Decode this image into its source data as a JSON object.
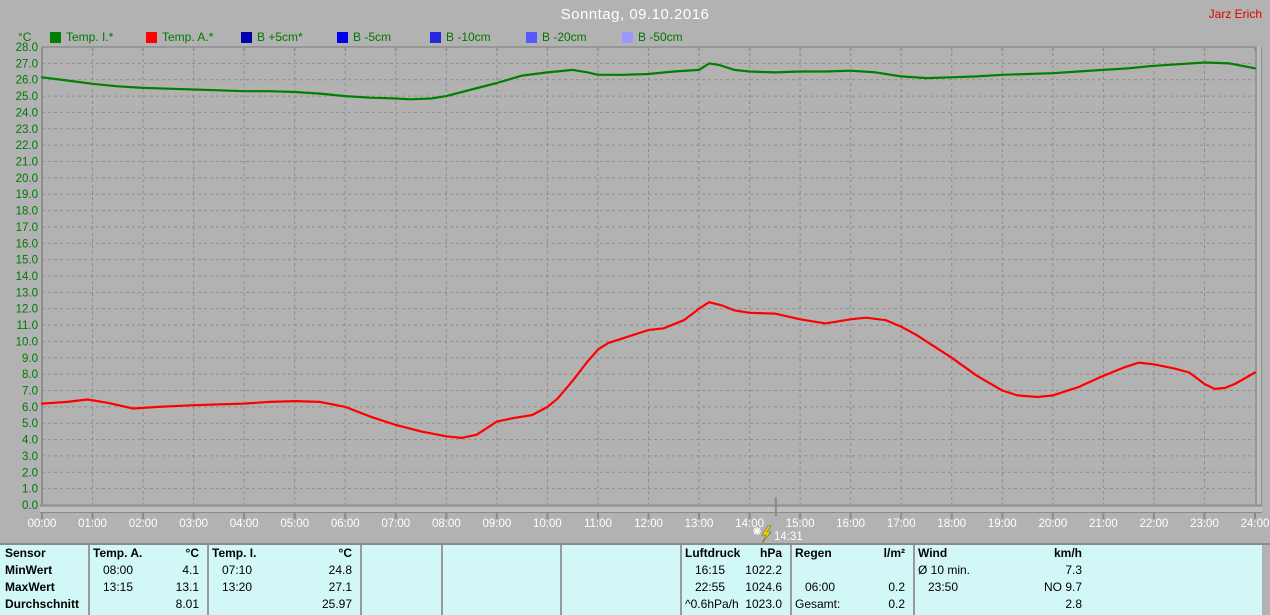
{
  "header": {
    "title": "Sonntag, 09.10.2016",
    "author": "Jarz Erich"
  },
  "legend": {
    "unit": "°C",
    "position": "top",
    "items": [
      {
        "label": "Temp. I.*",
        "color": "#008000"
      },
      {
        "label": "Temp. A.*",
        "color": "#ff0000"
      },
      {
        "label": "B +5cm*",
        "color": "#0000a8"
      },
      {
        "label": "B -5cm",
        "color": "#0000f0"
      },
      {
        "label": "B -10cm",
        "color": "#2626dd"
      },
      {
        "label": "B -20cm",
        "color": "#5858ff"
      },
      {
        "label": "B -50cm",
        "color": "#9898ff"
      }
    ]
  },
  "chart_data": {
    "type": "line",
    "title": "Sonntag, 09.10.2016",
    "grid": true,
    "legend_position": "top",
    "x_axis": {
      "min": 0,
      "max": 24,
      "step": 1,
      "tick_labels": [
        "00:00",
        "01:00",
        "02:00",
        "03:00",
        "04:00",
        "05:00",
        "06:00",
        "07:00",
        "08:00",
        "09:00",
        "10:00",
        "11:00",
        "12:00",
        "13:00",
        "14:00",
        "15:00",
        "16:00",
        "17:00",
        "18:00",
        "19:00",
        "20:00",
        "21:00",
        "22:00",
        "23:00",
        "24:00"
      ]
    },
    "y_axis": {
      "min": 0,
      "max": 28,
      "step": 1,
      "decimals": 1,
      "unit": "°C"
    },
    "cursor": {
      "label": "14:31",
      "hour": 14.52
    },
    "series": [
      {
        "name": "Temp. I.*",
        "color": "#008000",
        "points": [
          [
            0,
            26.15
          ],
          [
            0.5,
            25.95
          ],
          [
            1,
            25.75
          ],
          [
            1.5,
            25.6
          ],
          [
            2,
            25.5
          ],
          [
            2.5,
            25.45
          ],
          [
            3,
            25.4
          ],
          [
            3.5,
            25.35
          ],
          [
            4,
            25.3
          ],
          [
            4.5,
            25.3
          ],
          [
            5,
            25.25
          ],
          [
            5.5,
            25.15
          ],
          [
            6,
            25.0
          ],
          [
            6.5,
            24.9
          ],
          [
            7,
            24.85
          ],
          [
            7.3,
            24.8
          ],
          [
            7.7,
            24.85
          ],
          [
            8,
            25.0
          ],
          [
            8.5,
            25.4
          ],
          [
            9,
            25.8
          ],
          [
            9.5,
            26.25
          ],
          [
            10,
            26.45
          ],
          [
            10.5,
            26.6
          ],
          [
            10.8,
            26.45
          ],
          [
            11,
            26.3
          ],
          [
            11.5,
            26.3
          ],
          [
            12,
            26.35
          ],
          [
            12.5,
            26.5
          ],
          [
            13,
            26.6
          ],
          [
            13.2,
            27.0
          ],
          [
            13.4,
            26.9
          ],
          [
            13.7,
            26.6
          ],
          [
            14,
            26.5
          ],
          [
            14.5,
            26.45
          ],
          [
            15,
            26.5
          ],
          [
            15.5,
            26.5
          ],
          [
            16,
            26.55
          ],
          [
            16.5,
            26.45
          ],
          [
            17,
            26.2
          ],
          [
            17.5,
            26.1
          ],
          [
            18,
            26.15
          ],
          [
            18.5,
            26.2
          ],
          [
            19,
            26.3
          ],
          [
            19.5,
            26.35
          ],
          [
            20,
            26.4
          ],
          [
            20.5,
            26.5
          ],
          [
            21,
            26.6
          ],
          [
            21.5,
            26.7
          ],
          [
            22,
            26.85
          ],
          [
            22.5,
            26.95
          ],
          [
            23,
            27.05
          ],
          [
            23.5,
            27.0
          ],
          [
            24,
            26.7
          ]
        ]
      },
      {
        "name": "Temp. A.*",
        "color": "#ff0000",
        "points": [
          [
            0,
            6.2
          ],
          [
            0.5,
            6.3
          ],
          [
            0.9,
            6.45
          ],
          [
            1.3,
            6.25
          ],
          [
            1.8,
            5.9
          ],
          [
            2.3,
            6.0
          ],
          [
            3,
            6.1
          ],
          [
            3.5,
            6.15
          ],
          [
            4,
            6.2
          ],
          [
            4.5,
            6.3
          ],
          [
            5,
            6.35
          ],
          [
            5.5,
            6.3
          ],
          [
            6,
            6.0
          ],
          [
            6.5,
            5.4
          ],
          [
            7,
            4.9
          ],
          [
            7.5,
            4.5
          ],
          [
            8,
            4.2
          ],
          [
            8.3,
            4.1
          ],
          [
            8.6,
            4.3
          ],
          [
            9,
            5.1
          ],
          [
            9.3,
            5.3
          ],
          [
            9.7,
            5.5
          ],
          [
            10,
            6.0
          ],
          [
            10.2,
            6.5
          ],
          [
            10.5,
            7.6
          ],
          [
            10.8,
            8.8
          ],
          [
            11,
            9.5
          ],
          [
            11.2,
            9.9
          ],
          [
            11.5,
            10.2
          ],
          [
            12,
            10.7
          ],
          [
            12.3,
            10.8
          ],
          [
            12.7,
            11.3
          ],
          [
            13,
            12.0
          ],
          [
            13.2,
            12.4
          ],
          [
            13.45,
            12.2
          ],
          [
            13.7,
            11.9
          ],
          [
            14,
            11.75
          ],
          [
            14.5,
            11.7
          ],
          [
            15,
            11.35
          ],
          [
            15.5,
            11.1
          ],
          [
            16,
            11.35
          ],
          [
            16.3,
            11.45
          ],
          [
            16.7,
            11.3
          ],
          [
            17,
            10.9
          ],
          [
            17.3,
            10.4
          ],
          [
            17.6,
            9.8
          ],
          [
            18,
            9.0
          ],
          [
            18.5,
            7.9
          ],
          [
            19,
            7.0
          ],
          [
            19.3,
            6.7
          ],
          [
            19.7,
            6.6
          ],
          [
            20,
            6.7
          ],
          [
            20.5,
            7.2
          ],
          [
            21,
            7.9
          ],
          [
            21.4,
            8.4
          ],
          [
            21.7,
            8.7
          ],
          [
            22,
            8.6
          ],
          [
            22.4,
            8.35
          ],
          [
            22.7,
            8.1
          ],
          [
            23,
            7.4
          ],
          [
            23.2,
            7.1
          ],
          [
            23.4,
            7.15
          ],
          [
            23.6,
            7.4
          ],
          [
            24,
            8.1
          ]
        ]
      }
    ]
  },
  "table": {
    "row_labels": [
      "Sensor",
      "MinWert",
      "MaxWert",
      "Durchschnitt"
    ],
    "columns": [
      {
        "name": "Temp. A.",
        "unit": "°C",
        "rows": [
          [
            "08:00",
            "4.1"
          ],
          [
            "13:15",
            "13.1"
          ],
          [
            "",
            "8.01"
          ]
        ]
      },
      {
        "name": "Temp. I.",
        "unit": "°C",
        "rows": [
          [
            "07:10",
            "24.8"
          ],
          [
            "13:20",
            "27.1"
          ],
          [
            "",
            "25.97"
          ]
        ]
      },
      {
        "name": "",
        "unit": "",
        "rows": [
          [
            "",
            ""
          ],
          [
            "",
            ""
          ],
          [
            "",
            ""
          ]
        ]
      },
      {
        "name": "",
        "unit": "",
        "rows": [
          [
            "",
            ""
          ],
          [
            "",
            ""
          ],
          [
            "",
            ""
          ]
        ]
      },
      {
        "name": "",
        "unit": "",
        "rows": [
          [
            "",
            ""
          ],
          [
            "",
            ""
          ],
          [
            "",
            ""
          ]
        ]
      },
      {
        "name": "Luftdruck",
        "unit": "hPa",
        "rows": [
          [
            "16:15",
            "1022.2"
          ],
          [
            "22:55",
            "1024.6"
          ],
          [
            "^0.6hPa/h",
            "1023.0"
          ]
        ]
      },
      {
        "name": "Regen",
        "unit": "l/m²",
        "rows": [
          [
            "",
            ""
          ],
          [
            "06:00",
            "0.2"
          ],
          [
            "Gesamt:",
            "0.2"
          ]
        ]
      },
      {
        "name": "Wind",
        "unit": "km/h",
        "rows": [
          [
            "Ø 10 min.",
            "7.3"
          ],
          [
            "23:50",
            "NO 9.7"
          ],
          [
            "",
            "2.8"
          ]
        ]
      }
    ]
  },
  "colors": {
    "background": "#b2b2b2",
    "grid": "#8d8d8d",
    "y_labels": "#007800",
    "x_labels": "#ffffff",
    "table_background": "#d2f7f7",
    "title_text": "#ffffff",
    "author_text": "#dd0000",
    "cursor_bolt": "#f0d000"
  }
}
